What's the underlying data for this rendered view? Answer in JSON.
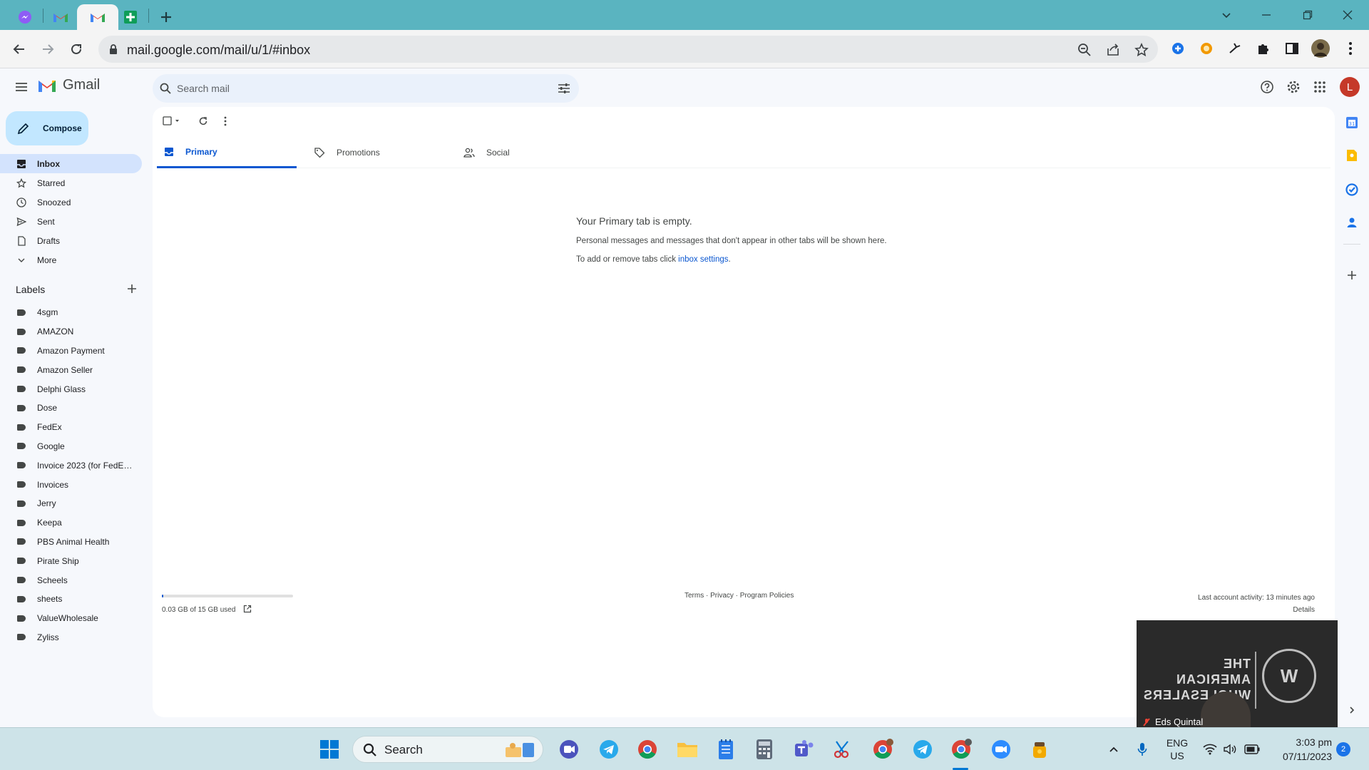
{
  "browser": {
    "url": "mail.google.com/mail/u/1/#inbox",
    "tabs": [
      "messenger-tab",
      "gmail-tab",
      "gmail-tab-active",
      "sheets-tab"
    ]
  },
  "gmail": {
    "brand": "Gmail",
    "search_placeholder": "Search mail",
    "avatar_initial": "L",
    "compose_label": "Compose",
    "nav": [
      {
        "label": "Inbox",
        "icon": "inbox-icon",
        "active": true
      },
      {
        "label": "Starred",
        "icon": "star-icon"
      },
      {
        "label": "Snoozed",
        "icon": "clock-icon"
      },
      {
        "label": "Sent",
        "icon": "send-icon"
      },
      {
        "label": "Drafts",
        "icon": "draft-icon"
      },
      {
        "label": "More",
        "icon": "chevron-down-icon"
      }
    ],
    "labels_title": "Labels",
    "labels": [
      "4sgm",
      "AMAZON",
      "Amazon Payment",
      "Amazon Seller",
      "Delphi Glass",
      "Dose",
      "FedEx",
      "Google",
      "Invoice 2023 (for FedEx ...",
      "Invoices",
      "Jerry",
      "Keepa",
      "PBS Animal Health",
      "Pirate Ship",
      "Scheels",
      "sheets",
      "ValueWholesale",
      "Zyliss"
    ],
    "inbox_tabs": [
      {
        "label": "Primary",
        "active": true
      },
      {
        "label": "Promotions"
      },
      {
        "label": "Social"
      }
    ],
    "empty": {
      "title": "Your Primary tab is empty.",
      "line1": "Personal messages and messages that don't appear in other tabs will be shown here.",
      "line2_prefix": "To add or remove tabs click ",
      "line2_link": "inbox settings",
      "line2_suffix": "."
    },
    "footer": {
      "storage": "0.03 GB of 15 GB used",
      "storage_fraction": 0.002,
      "links": "Terms · Privacy · Program Policies",
      "activity": "Last account activity: 13 minutes ago",
      "details": "Details"
    }
  },
  "video": {
    "title_mirrored": "THE AMERICAN WHOLESALERS",
    "name": "Eds Quintal"
  },
  "taskbar": {
    "search": "Search",
    "lang1": "ENG",
    "lang2": "US",
    "time": "3:03 pm",
    "date": "07/11/2023",
    "notifications": "2"
  },
  "colors": {
    "tabstrip": "#5ab4c0",
    "accent": "#0b57d0",
    "compose": "#c2e7ff",
    "nav_active": "#d3e3fd"
  }
}
